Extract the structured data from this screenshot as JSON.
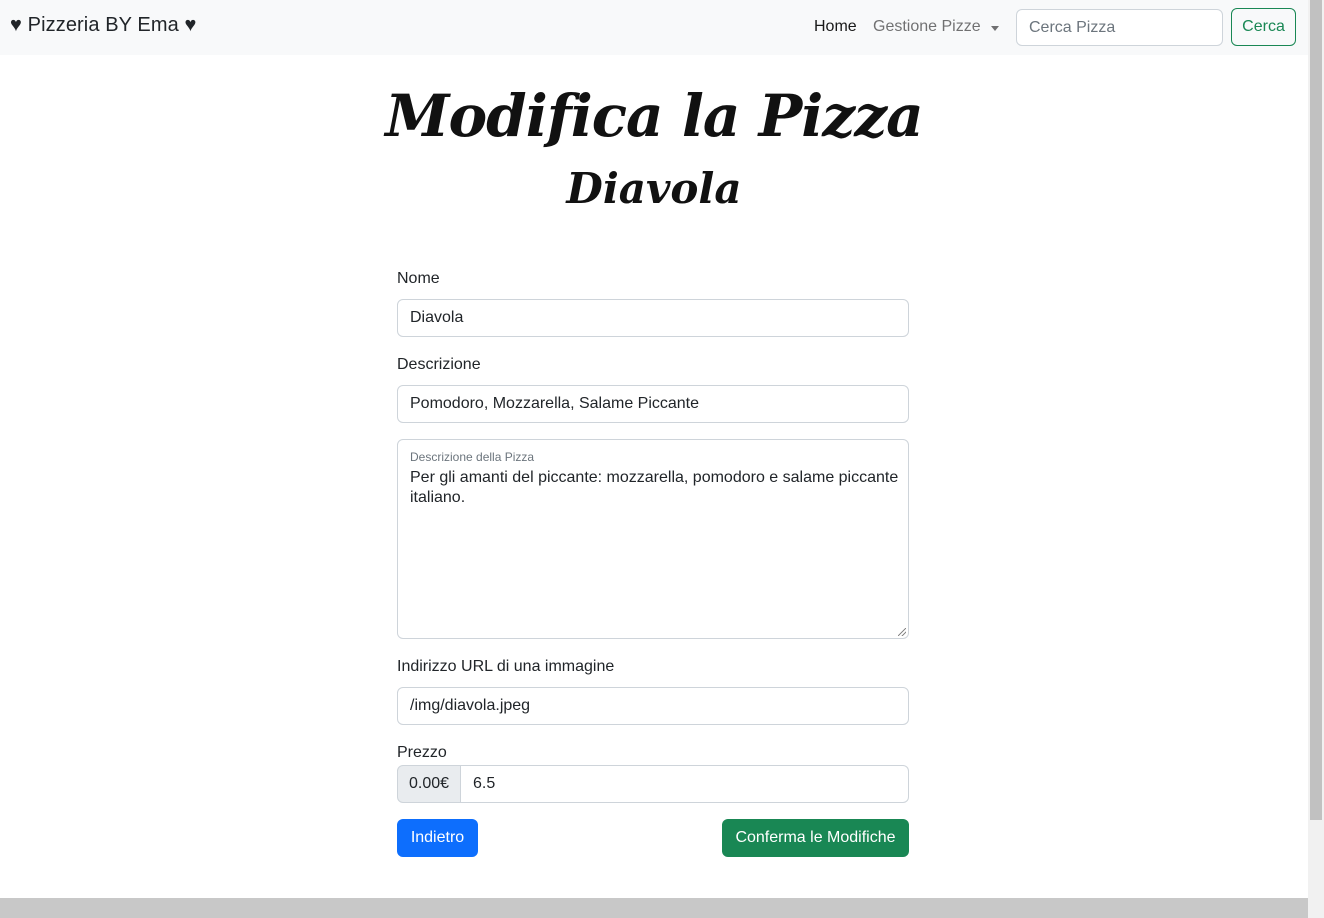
{
  "navbar": {
    "brand": "♥ Pizzeria BY Ema ♥",
    "home_label": "Home",
    "dropdown_label": "Gestione Pizze",
    "search_placeholder": "Cerca Pizza",
    "search_button": "Cerca"
  },
  "header": {
    "title": "Modifica la Pizza",
    "subtitle": "Diavola"
  },
  "form": {
    "name_label": "Nome",
    "name_value": "Diavola",
    "description_label": "Descrizione",
    "description_value": "Pomodoro, Mozzarella, Salame Piccante",
    "long_description_label": "Descrizione della Pizza",
    "long_description_value": "Per gli amanti del piccante: mozzarella, pomodoro e salame piccante italiano.",
    "image_label": "Indirizzo URL di una immagine",
    "image_value": "/img/diavola.jpeg",
    "price_label": "Prezzo",
    "price_prefix": "0.00€",
    "price_value": "6.5",
    "back_button": "Indietro",
    "confirm_button": "Conferma le Modifiche"
  },
  "colors": {
    "primary": "#0d6efd",
    "success": "#198754",
    "navbar_bg": "#f8f9fa"
  }
}
